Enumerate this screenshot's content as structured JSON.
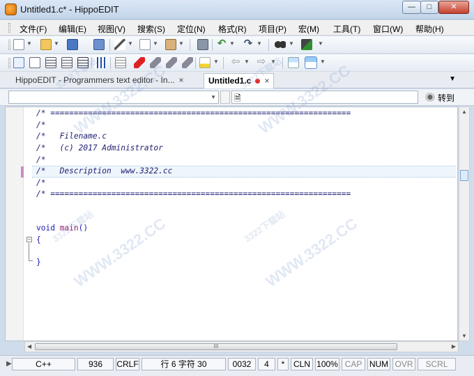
{
  "window": {
    "title": "Untitled1.c* - HippoEDIT",
    "minimize": "—",
    "maximize": "□",
    "close": "✕"
  },
  "menu": [
    "文件(F)",
    "编辑(E)",
    "视图(V)",
    "搜索(S)",
    "定位(N)",
    "格式(R)",
    "项目(P)",
    "宏(M)",
    "工具(T)",
    "窗口(W)",
    "帮助(H)"
  ],
  "tabs": {
    "inactive": "HippoEDIT - Programmers text editor - In...",
    "active": "Untitled1.c",
    "close_glyph": "×",
    "overflow_glyph": "▼"
  },
  "navbar": {
    "goto_label": "转到"
  },
  "editor": {
    "lines": [
      "/* ================================================================",
      "/*",
      "/*   Filename.c",
      "/*   (c) 2017 Administrator",
      "/*",
      "/*   Description  www.3322.cc",
      "/*",
      "/* ================================================================",
      "",
      "",
      "void main()",
      "{",
      "",
      "}"
    ],
    "fold_glyph": "−",
    "hscroll_grip": "III"
  },
  "status": {
    "lang": "C++",
    "codepage": "936",
    "eol": "CRLF",
    "position": "行   6 字符  30",
    "char_code": "0032",
    "tab_size": "4",
    "star": "*",
    "cln": "CLN",
    "zoom": "100%",
    "cap": "CAP",
    "num": "NUM",
    "ovr": "OVR",
    "scrl": "SCRL"
  },
  "watermark": {
    "big": "WWW.3322.CC",
    "small": "3322下载站"
  },
  "colors": {
    "accent": "#5a8fd0",
    "comment": "#1e1e72",
    "keyword": "#1b1bb0",
    "function": "#8b1b6f",
    "dirty": "#e03030"
  },
  "icons": {
    "toolbar1": [
      "new-file-icon",
      "open-file-icon",
      "save-icon",
      "save-all-icon",
      "cut-icon",
      "copy-icon",
      "paste-icon",
      "print-icon",
      "undo-icon",
      "redo-icon",
      "find-icon",
      "replace-icon"
    ],
    "toolbar2": [
      "checklist-icon",
      "document-list-icon",
      "list-icon",
      "list-alt-icon",
      "indent-icon",
      "column-icon",
      "bookmark-icon",
      "tag-icon",
      "tag-alt-icon",
      "tag-next-icon",
      "highlight-icon",
      "back-icon",
      "forward-icon",
      "spell-check-icon",
      "auto-spell-check-icon"
    ]
  }
}
